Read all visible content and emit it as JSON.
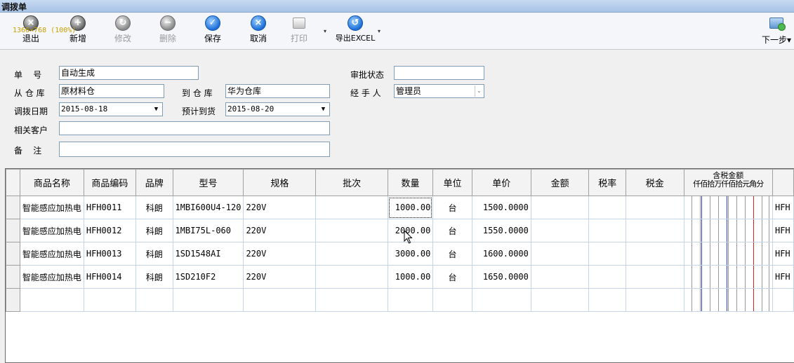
{
  "window": {
    "title": "调拨单",
    "resolution_text": "1366×768 (100%)"
  },
  "toolbar": {
    "buttons": [
      {
        "label": "退出",
        "icon": "exit-icon",
        "enabled": true
      },
      {
        "label": "新增",
        "icon": "add-icon",
        "enabled": true
      },
      {
        "label": "修改",
        "icon": "edit-icon",
        "enabled": false
      },
      {
        "label": "删除",
        "icon": "delete-icon",
        "enabled": false
      },
      {
        "label": "保存",
        "icon": "save-icon",
        "enabled": true
      },
      {
        "label": "取消",
        "icon": "cancel-icon",
        "enabled": true
      },
      {
        "label": "打印",
        "icon": "printer-icon",
        "enabled": false
      },
      {
        "label": "导出EXCEL",
        "icon": "export-icon",
        "enabled": true
      }
    ],
    "next_step": "下一步"
  },
  "form": {
    "order_no": {
      "label": "单    号",
      "value": "自动生成"
    },
    "from_warehouse": {
      "label": "从 仓 库",
      "value": "原材料仓"
    },
    "to_warehouse": {
      "label": "到 仓 库",
      "value": "华为仓库"
    },
    "transfer_date": {
      "label": "调拨日期",
      "value": "2015-08-18"
    },
    "expected_date": {
      "label": "预计到货",
      "value": "2015-08-20"
    },
    "customer": {
      "label": "相关客户",
      "value": ""
    },
    "remark": {
      "label": "备    注",
      "value": ""
    },
    "approval_status": {
      "label": "审批状态",
      "value": ""
    },
    "handler": {
      "label": "经 手 人",
      "value": "管理员"
    }
  },
  "grid": {
    "columns": [
      "商品名称",
      "商品编码",
      "品牌",
      "型号",
      "规格",
      "批次",
      "数量",
      "单位",
      "单价",
      "金额",
      "税率",
      "税金"
    ],
    "amount_header": {
      "title": "含税金额",
      "digits": "仟佰拾万仟佰拾元角分"
    },
    "rows": [
      {
        "name": "智能感应加热电",
        "code": "HFH0011",
        "brand": "科朗",
        "model": "1MBI600U4-120",
        "spec": "220V",
        "batch": "",
        "qty": "1000.00",
        "unit": "台",
        "price": "1500.0000",
        "amount": "",
        "tax_rate": "",
        "tax": "",
        "trail": "HFH"
      },
      {
        "name": "智能感应加热电",
        "code": "HFH0012",
        "brand": "科朗",
        "model": "1MBI75L-060",
        "spec": "220V",
        "batch": "",
        "qty": "2000.00",
        "unit": "台",
        "price": "1550.0000",
        "amount": "",
        "tax_rate": "",
        "tax": "",
        "trail": "HFH"
      },
      {
        "name": "智能感应加热电",
        "code": "HFH0013",
        "brand": "科朗",
        "model": "1SD1548AI",
        "spec": "220V",
        "batch": "",
        "qty": "3000.00",
        "unit": "台",
        "price": "1600.0000",
        "amount": "",
        "tax_rate": "",
        "tax": "",
        "trail": "HFH"
      },
      {
        "name": "智能感应加热电",
        "code": "HFH0014",
        "brand": "科朗",
        "model": "1SD210F2",
        "spec": "220V",
        "batch": "",
        "qty": "1000.00",
        "unit": "台",
        "price": "1650.0000",
        "amount": "",
        "tax_rate": "",
        "tax": "",
        "trail": "HFH"
      },
      {
        "name": "",
        "code": "",
        "brand": "",
        "model": "",
        "spec": "",
        "batch": "",
        "qty": "",
        "unit": "",
        "price": "",
        "amount": "",
        "tax_rate": "",
        "tax": "",
        "trail": ""
      }
    ]
  }
}
